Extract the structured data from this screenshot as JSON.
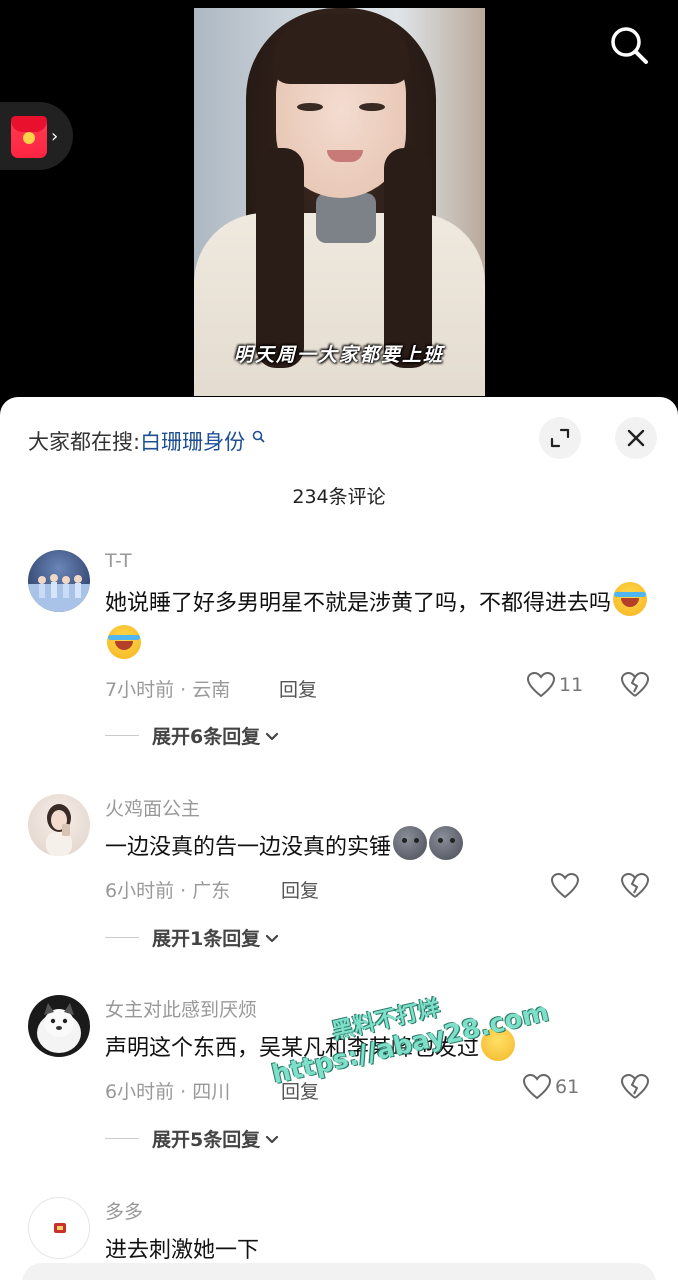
{
  "video": {
    "subtitle": "明天周一大家都要上班",
    "search_icon": "search-icon",
    "red_packet_icon": "red-packet-icon"
  },
  "sheet": {
    "hot_search_prefix": "大家都在搜:",
    "hot_search_term": "白珊珊身份",
    "comment_count": "234条评论",
    "comments": [
      {
        "user": "T-T",
        "text": "她说睡了好多男明星不就是涉黄了吗，不都得进去吗",
        "emojis": [
          "loudly-crying-emoji",
          "loudly-crying-emoji"
        ],
        "meta": "7小时前 · 云南",
        "reply": "回复",
        "likes": "11",
        "expand": "展开6条回复"
      },
      {
        "user": "火鸡面公主",
        "text": "一边没真的告一边没真的实锤",
        "emojis": [
          "new-moon-face-emoji",
          "new-moon-face-emoji"
        ],
        "meta": "6小时前 · 广东",
        "reply": "回复",
        "likes": "",
        "expand": "展开1条回复"
      },
      {
        "user": "女主对此感到厌烦",
        "text": "声明这个东西，吴某凡和李某峰也发过",
        "emojis": [
          "smirk-emoji"
        ],
        "meta": "6小时前 · 四川",
        "reply": "回复",
        "likes": "61",
        "expand": "展开5条回复"
      },
      {
        "user": "多多",
        "text": "进去刺激她一下"
      }
    ]
  },
  "watermark": {
    "line1": "黑料不打烊",
    "line2": "https://abay28.com"
  },
  "colors": {
    "link_blue": "#1e4f96",
    "muted_gray": "#999999",
    "watermark_green": "#7fe0c9",
    "red_packet": "#ff2442"
  }
}
